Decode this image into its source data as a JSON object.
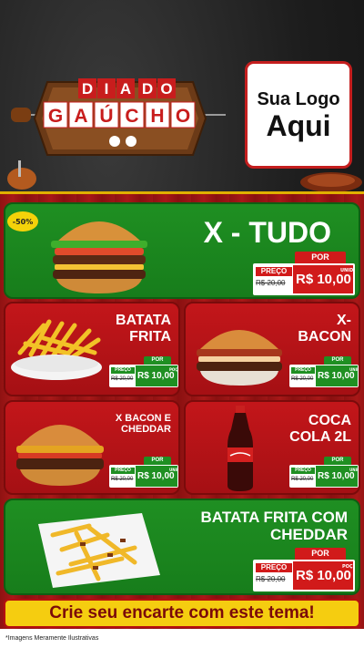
{
  "header": {
    "emblem_line1": "DIA DO",
    "emblem_line2": "GAÚCHO",
    "logo_line1": "Sua Logo",
    "logo_line2": "Aqui"
  },
  "badge": "-50%",
  "products": [
    {
      "title": "X - TUDO",
      "por": "POR",
      "preco": "PREÇO",
      "old": "R$ 20,00",
      "new": "R$ 10,00",
      "unit": "UNID"
    },
    {
      "title_line1": "BATATA",
      "title_line2": "FRITA",
      "por": "POR",
      "preco": "PREÇO",
      "old": "R$ 20,00",
      "new": "R$ 10,00",
      "unit": "POÇ"
    },
    {
      "title_line1": "X-",
      "title_line2": "BACON",
      "por": "POR",
      "preco": "PREÇO",
      "old": "R$ 20,00",
      "new": "R$ 10,00",
      "unit": "UNID"
    },
    {
      "title_line1": "X BACON E",
      "title_line2": "CHEDDAR",
      "por": "POR",
      "preco": "PREÇO",
      "old": "R$ 20,00",
      "new": "R$ 10,00",
      "unit": "UNID"
    },
    {
      "title_line1": "COCA",
      "title_line2": "COLA 2L",
      "por": "POR",
      "preco": "PREÇO",
      "old": "R$ 20,00",
      "new": "R$ 10,00",
      "unit": "UNID"
    },
    {
      "title_line1": "BATATA FRITA COM",
      "title_line2": "CHEDDAR",
      "por": "POR",
      "preco": "PREÇO",
      "old": "R$ 20,00",
      "new": "R$ 10,00",
      "unit": "POÇ"
    }
  ],
  "banner": "Crie seu encarte com este tema!",
  "footer": "*Imagens Meramente Ilustrativas",
  "colors": {
    "green": "#1f8f22",
    "red": "#c3161a",
    "yellow": "#f5cd10",
    "wood": "#9c1616"
  }
}
